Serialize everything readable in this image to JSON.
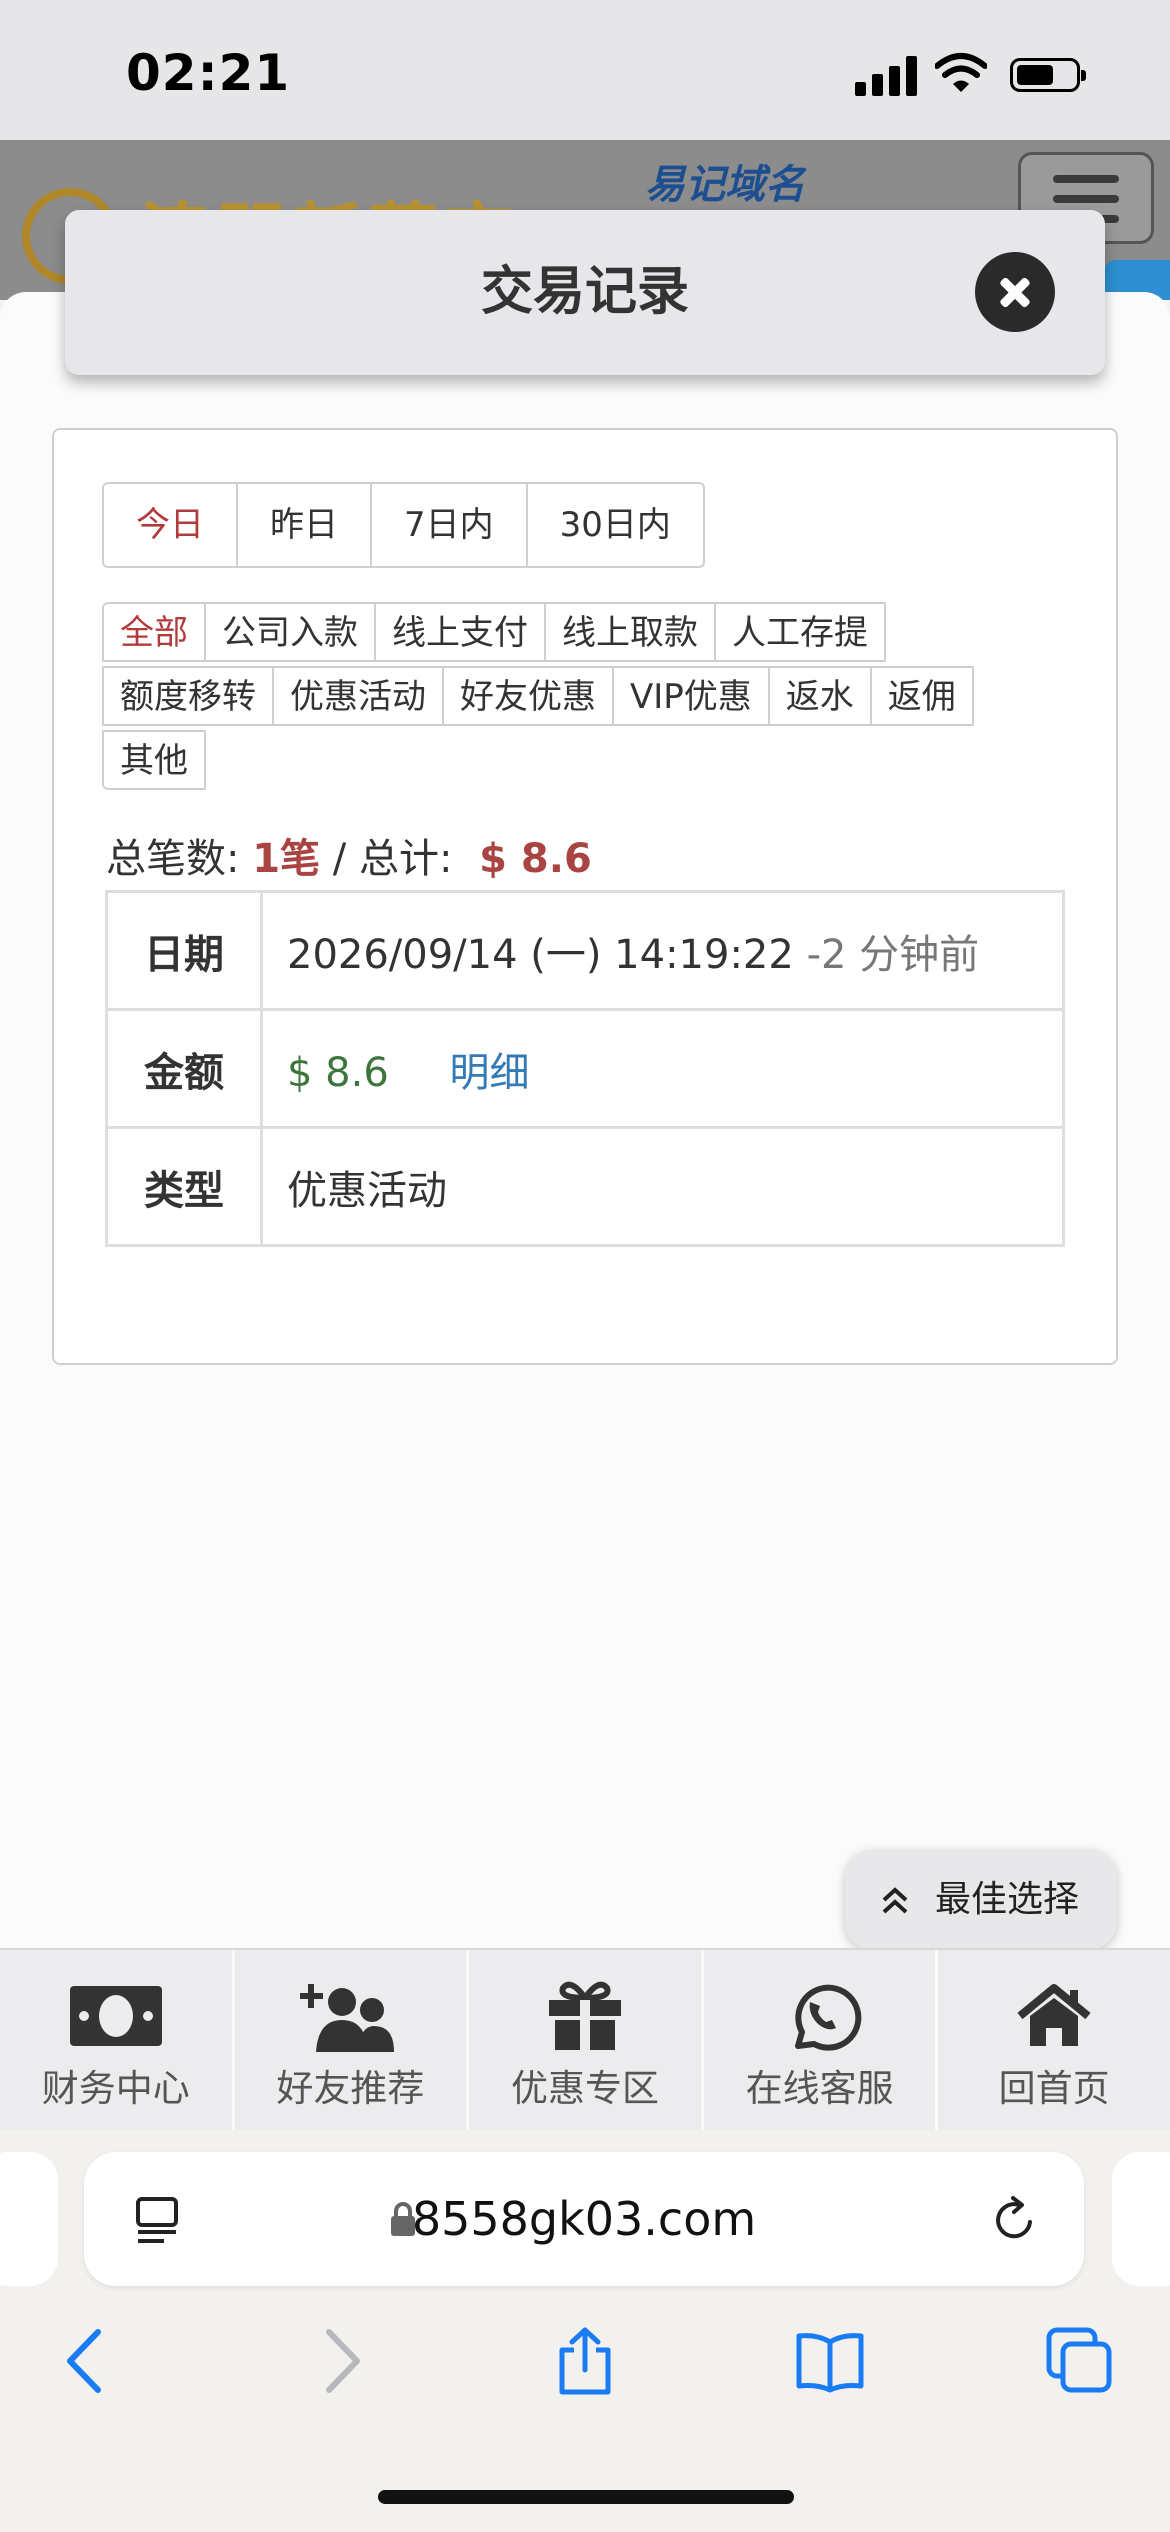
{
  "status_bar": {
    "time": "02:21"
  },
  "site": {
    "logo_text": "澳門新葡京",
    "domain_link": "易记域名"
  },
  "modal": {
    "title": "交易记录",
    "date_tabs": [
      {
        "label": "今日",
        "active": true
      },
      {
        "label": "昨日",
        "active": false
      },
      {
        "label": "7日内",
        "active": false
      },
      {
        "label": "30日内",
        "active": false
      }
    ],
    "type_tabs": [
      [
        {
          "label": "全部",
          "active": true
        },
        {
          "label": "公司入款",
          "active": false
        },
        {
          "label": "线上支付",
          "active": false
        },
        {
          "label": "线上取款",
          "active": false
        },
        {
          "label": "人工存提",
          "active": false
        }
      ],
      [
        {
          "label": "额度移转",
          "active": false
        },
        {
          "label": "优惠活动",
          "active": false
        },
        {
          "label": "好友优惠",
          "active": false
        },
        {
          "label": "VIP优惠",
          "active": false
        },
        {
          "label": "返水",
          "active": false
        },
        {
          "label": "返佣",
          "active": false
        }
      ],
      [
        {
          "label": "其他",
          "active": false
        }
      ]
    ],
    "summary": {
      "count_label": "总笔数:",
      "count_value": "1笔",
      "separator": "/",
      "total_label": "总计:",
      "total_value": "$ 8.6"
    },
    "record": {
      "date_key": "日期",
      "date_value": "2026/09/14 (一) 14:19:22",
      "date_ago": "-2 分钟前",
      "amount_key": "金额",
      "amount_value": "$ 8.6",
      "detail_link": "明细",
      "type_key": "类型",
      "type_value": "优惠活动"
    }
  },
  "best_choice_button": "最佳选择",
  "bottom_nav": [
    {
      "label": "财务中心",
      "icon": "money-icon"
    },
    {
      "label": "好友推荐",
      "icon": "add-user-icon"
    },
    {
      "label": "优惠专区",
      "icon": "gift-icon"
    },
    {
      "label": "在线客服",
      "icon": "whatsapp-icon"
    },
    {
      "label": "回首页",
      "icon": "home-icon"
    }
  ],
  "browser": {
    "url": "8558gk03.com"
  },
  "colors": {
    "active_red": "#b33a3a",
    "amount_green": "#3c763d",
    "link_blue": "#337ab7",
    "summary_red": "#a94442"
  }
}
